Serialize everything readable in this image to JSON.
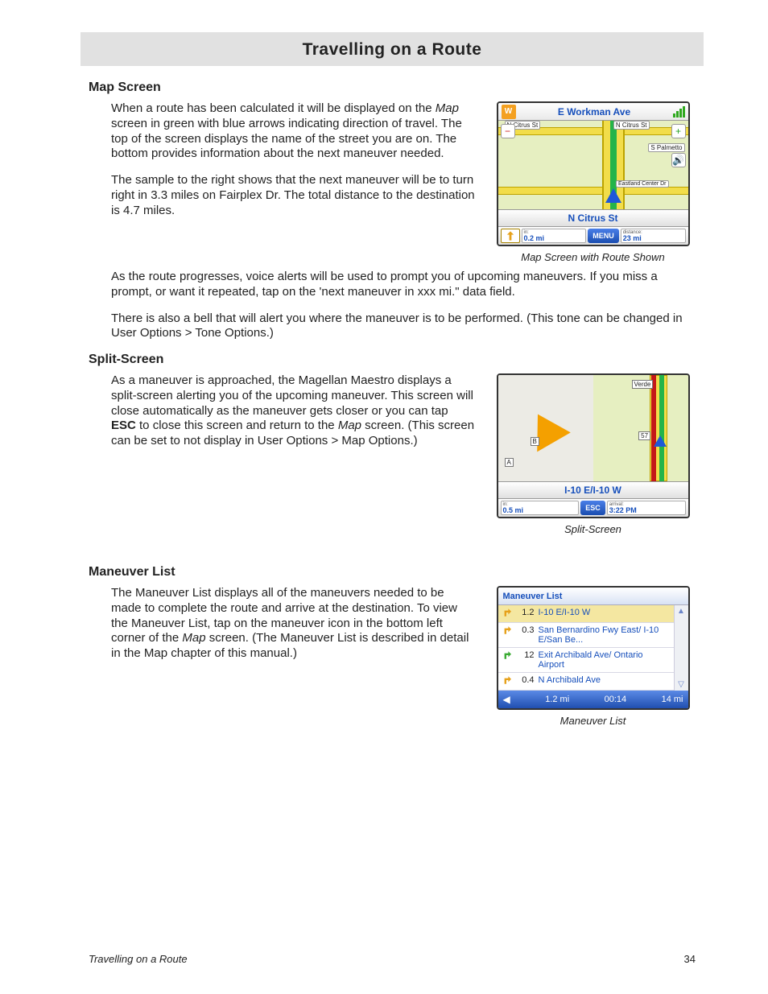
{
  "page_title": "Travelling on a Route",
  "footer": {
    "left": "Travelling on a Route",
    "page": "34"
  },
  "sections": {
    "map_screen": {
      "heading": "Map Screen",
      "p1a": "When a route has been calculated it will be displayed on the ",
      "p1b": "Map",
      "p1c": " screen in green with blue arrows indicating direction of travel.  The top of the screen displays the name of the street you are on.  The bottom provides information about the next maneuver needed.",
      "p2": "The sample to the right shows that the next maneuver will be to turn right in 3.3 miles on Fairplex Dr.  The total distance to the destination is 4.7 miles.",
      "p3": "As the route progresses, voice alerts will be used to prompt you of upcoming maneuvers.  If you miss a prompt, or want it repeated, tap on the 'next maneuver in xxx mi.\" data field.",
      "p4": "There is also a bell that will alert you where the maneuver is to be performed. (This tone can be changed in User Options >  Tone Options.)"
    },
    "split": {
      "heading": "Split-Screen",
      "p1a": "As a maneuver is approached, the Magellan Maestro displays a split-screen alerting you of the upcoming maneuver. This screen will close automatically as the maneuver gets closer or you can tap ",
      "p1b": "ESC",
      "p1c": " to close this screen and return to the ",
      "p1d": "Map",
      "p1e": " screen. (This screen can be set to not display in User Options > Map Options.)"
    },
    "mlist": {
      "heading": "Maneuver List",
      "p1a": "The Maneuver List displays all of the maneuvers needed to be made to complete the route and arrive at the destination.  To view the Maneuver List, tap on the maneuver icon in the bottom left corner of the ",
      "p1b": "Map",
      "p1c": " screen.   (The Maneuver List is described in detail in the Map chapter of this manual.)"
    }
  },
  "fig1": {
    "caption": "Map Screen with Route Shown",
    "compass": "W",
    "top_street": "E Workman Ave",
    "labels": {
      "nc1": "N Citrus St",
      "nc2": "N Citrus St",
      "palmetto": "S Palmetto",
      "eastland": "Eastland Center Dr"
    },
    "current_street": "N Citrus St",
    "bottom": {
      "in_label": "in:",
      "in_value": "0.2 mi",
      "menu": "MENU",
      "dist_label": "distance:",
      "dist_value": "23 mi"
    }
  },
  "fig2": {
    "caption": "Split-Screen",
    "labels": {
      "verde": "Verde",
      "A": "A",
      "B": "B",
      "hwy": "57"
    },
    "street": "I-10 E/I-10 W",
    "bottom": {
      "in_label": "in:",
      "in_value": "0.5 mi",
      "esc": "ESC",
      "arr_label": "arrival:",
      "arr_value": "3:22 PM"
    }
  },
  "fig3": {
    "caption": "Maneuver List",
    "title": "Maneuver List",
    "rows": [
      {
        "dist": "1.2",
        "name": "I-10 E/I-10 W",
        "selected": true,
        "icon_color": "#e6a11a"
      },
      {
        "dist": "0.3",
        "name": "San Bernardino Fwy East/ I-10 E/San Be...",
        "selected": false,
        "icon_color": "#e6a11a"
      },
      {
        "dist": "12",
        "name": "Exit Archibald Ave/ Ontario Airport",
        "selected": false,
        "icon_color": "#3aab33"
      },
      {
        "dist": "0.4",
        "name": "N Archibald Ave",
        "selected": false,
        "icon_color": "#e6a11a"
      }
    ],
    "footer": {
      "dist": "1.2 mi",
      "time": "00:14",
      "remain": "14 mi"
    }
  }
}
